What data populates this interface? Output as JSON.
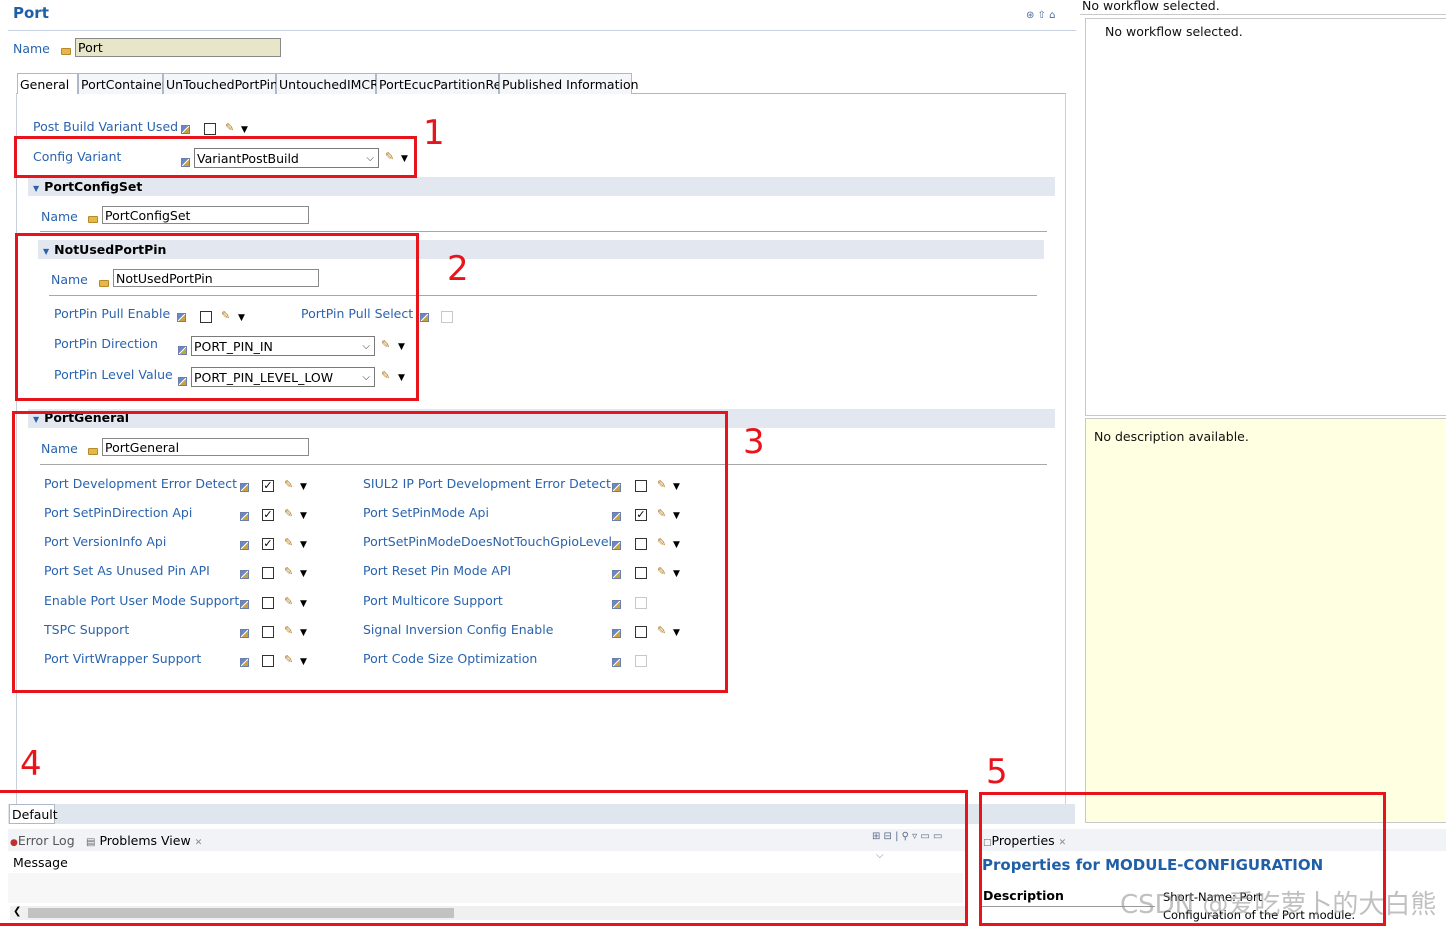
{
  "editor": {
    "title": "Port",
    "name_label": "Name",
    "name_value": "Port",
    "tabs": [
      "General",
      "PortContainer",
      "UnTouchedPortPin",
      "UntouchedIMCR",
      "PortEcucPartitionRef",
      "Published Information"
    ],
    "post_build_variant_used": "Post Build Variant Used",
    "config_variant_label": "Config Variant",
    "config_variant_value": "VariantPostBuild",
    "port_config_set": {
      "header": "PortConfigSet",
      "name_label": "Name",
      "name_value": "PortConfigSet"
    },
    "not_used_port_pin": {
      "header": "NotUsedPortPin",
      "name_label": "Name",
      "name_value": "NotUsedPortPin",
      "pull_enable": "PortPin Pull Enable",
      "pull_select": "PortPin Pull Select",
      "direction_label": "PortPin Direction",
      "direction_value": "PORT_PIN_IN",
      "level_label": "PortPin Level Value",
      "level_value": "PORT_PIN_LEVEL_LOW"
    },
    "port_general": {
      "header": "PortGeneral",
      "name_label": "Name",
      "name_value": "PortGeneral",
      "left": [
        {
          "label": "Port Development Error Detect",
          "checked": true
        },
        {
          "label": "Port SetPinDirection Api",
          "checked": true
        },
        {
          "label": "Port VersionInfo Api",
          "checked": true
        },
        {
          "label": "Port Set As Unused Pin API",
          "checked": false
        },
        {
          "label": "Enable Port User Mode Support",
          "checked": false
        },
        {
          "label": "TSPC Support",
          "checked": false
        },
        {
          "label": "Port VirtWrapper Support",
          "checked": false
        }
      ],
      "right": [
        {
          "label": "SIUL2 IP Port Development Error Detect",
          "checked": false,
          "editable": true
        },
        {
          "label": "Port SetPinMode Api",
          "checked": true,
          "editable": true
        },
        {
          "label": "PortSetPinModeDoesNotTouchGpioLevel",
          "checked": false,
          "editable": true
        },
        {
          "label": "Port Reset Pin Mode API",
          "checked": false,
          "editable": true
        },
        {
          "label": "Port Multicore Support",
          "checked": false,
          "editable": false
        },
        {
          "label": "Signal Inversion Config Enable",
          "checked": false,
          "editable": true
        },
        {
          "label": "Port Code Size Optimization",
          "checked": false,
          "editable": false
        }
      ]
    },
    "default_tab": "Default"
  },
  "right_panel": {
    "workflow_header": "No workflow selected.",
    "workflow_body": "No workflow selected.",
    "description": "No description available."
  },
  "bottom_left": {
    "tab_error_log": "Error Log",
    "tab_problems": "Problems View",
    "column_message": "Message"
  },
  "properties": {
    "tab": "Properties",
    "title": "Properties for MODULE-CONFIGURATION",
    "description_label": "Description",
    "short_name": "Short-Name: Port",
    "desc_text": "Configuration of the Port module.",
    "watermark": "CSDN @爱吃萝卜的大白熊"
  },
  "annotations": [
    "1",
    "2",
    "3",
    "4",
    "5"
  ],
  "colors": {
    "label_blue": "#2a63ad",
    "red_box": "#e8141b",
    "section_bg": "#e3e8f0",
    "description_bg": "#ffffe1"
  }
}
